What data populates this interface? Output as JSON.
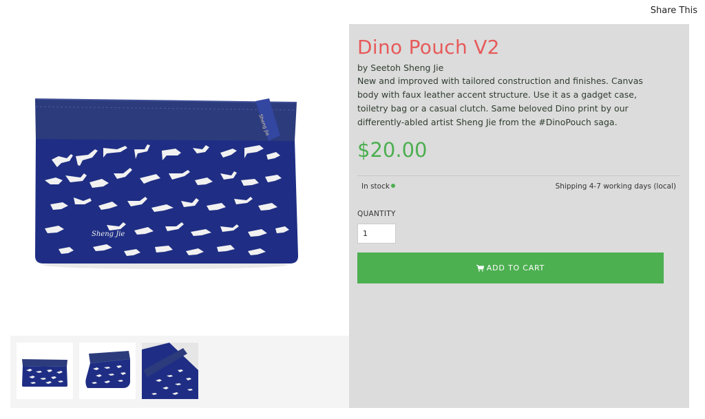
{
  "header": {
    "share_label": "Share This"
  },
  "product": {
    "title": "Dino  Pouch V2",
    "byline": "by Seetoh Sheng Jie",
    "description": "New and improved with tailored construction and finishes. Canvas body with faux leather accent structure. Use it as a gadget case, toiletry bag or a casual clutch. Same beloved Dino print by our differently-abled artist Sheng Jie from the #DinoPouch saga.",
    "price": "$20.00",
    "stock_status": "In stock",
    "shipping_info": "Shipping 4-7 working days (local)",
    "quantity_label": "QUANTITY",
    "quantity_value": "1",
    "add_to_cart_label": "ADD TO CART",
    "tag_text": "Sheng Jie",
    "print_signature": "Sheng Jie"
  },
  "colors": {
    "title": "#e75a5a",
    "price": "#4caf50",
    "button": "#4caf50",
    "stock_dot": "#4caf50",
    "pouch_navy": "#1f2e84",
    "pouch_leather": "#2c3b7c"
  },
  "icons": {
    "cart": "cart-icon"
  }
}
